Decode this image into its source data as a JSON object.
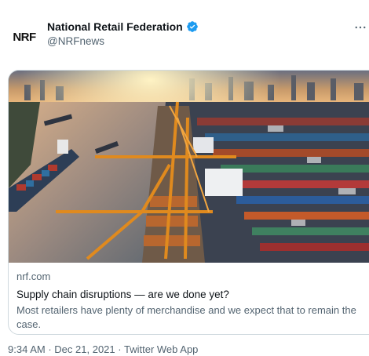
{
  "tweet": {
    "author": {
      "avatar_text": "NRF",
      "display_name": "National Retail Federation",
      "handle": "@NRFnews",
      "verified": true
    },
    "more_icon": "more-icon",
    "card": {
      "domain": "nrf.com",
      "title": "Supply chain disruptions — are we done yet?",
      "description": "Most retailers have plenty of merchandise and we expect that to remain the case."
    },
    "meta": {
      "time": "9:34 AM",
      "separator": "·",
      "date": "Dec 21, 2021",
      "source": "Twitter Web App"
    }
  },
  "colors": {
    "verified_blue": "#1d9bf0",
    "secondary_text": "#536471",
    "border": "#cfd9de"
  }
}
